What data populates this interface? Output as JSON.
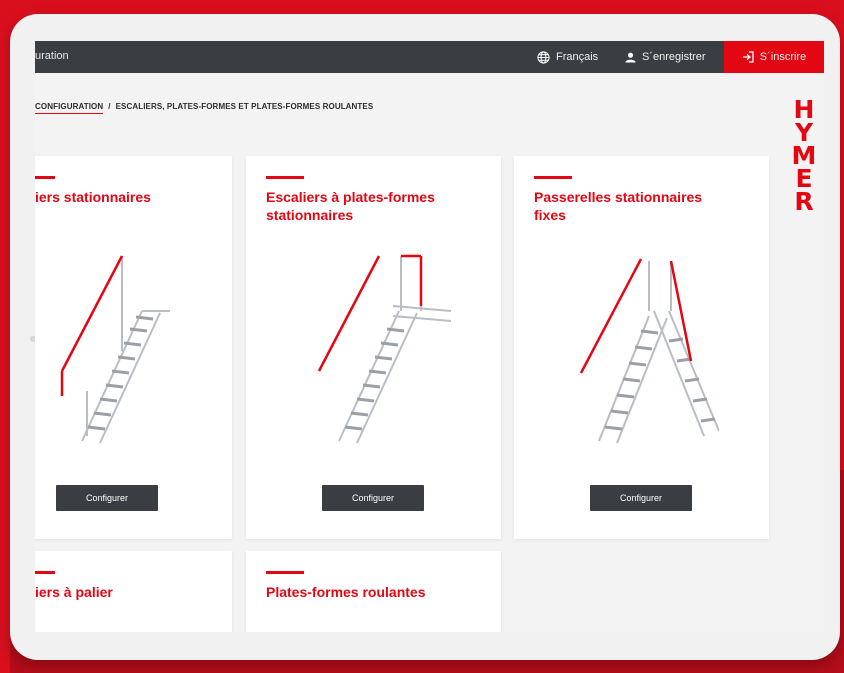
{
  "topbar": {
    "left_label": "uration",
    "language": "Français",
    "register": "S´enregistrer",
    "login": "S´inscrire"
  },
  "breadcrumb": {
    "first": "CONFIGURATION",
    "separator": "/",
    "current": "ESCALIERS, PLATES-FORMES ET PLATES-FORMES ROULANTES"
  },
  "logo": {
    "letters": [
      "H",
      "Y",
      "M",
      "E",
      "R"
    ]
  },
  "cards": [
    {
      "title": "iers stationnaires",
      "button": "Configurer"
    },
    {
      "title": "Escaliers à plates-formes stationnaires",
      "button": "Configurer"
    },
    {
      "title": "Passerelles stationnaires fixes",
      "button": "Configurer"
    },
    {
      "title": "iers à palier"
    },
    {
      "title": "Plates-formes roulantes"
    }
  ],
  "colors": {
    "brand": "#e30613",
    "dark": "#3a3e42",
    "background": "#d90f1d"
  }
}
